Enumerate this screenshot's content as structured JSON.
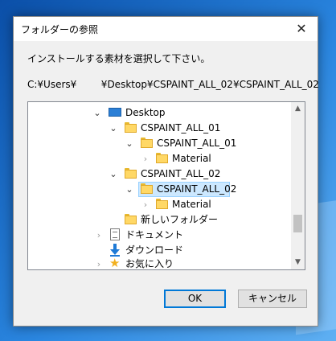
{
  "dialog": {
    "title": "フォルダーの参照",
    "close_glyph": "✕",
    "instruction": "インストールする素材を選択して下さい。",
    "path": "C:¥Users¥        ¥Desktop¥CSPAINT_ALL_02¥CSPAINT_ALL_02"
  },
  "tree": {
    "items": [
      {
        "label": "Desktop",
        "expanded": true,
        "icon": "desktop-icon"
      },
      {
        "label": "CSPAINT_ALL_01",
        "expanded": true,
        "icon": "folder-icon"
      },
      {
        "label": "CSPAINT_ALL_01",
        "expanded": true,
        "icon": "folder-icon"
      },
      {
        "label": "Material",
        "expanded": false,
        "icon": "folder-icon"
      },
      {
        "label": "CSPAINT_ALL_02",
        "expanded": true,
        "icon": "folder-icon"
      },
      {
        "label": "CSPAINT_ALL_02",
        "expanded": true,
        "icon": "folder-icon",
        "selected": true
      },
      {
        "label": "Material",
        "expanded": false,
        "icon": "folder-icon"
      },
      {
        "label": "新しいフォルダー",
        "icon": "folder-icon"
      },
      {
        "label": "ドキュメント",
        "expanded": false,
        "icon": "document-icon"
      },
      {
        "label": "ダウンロード",
        "icon": "download-icon"
      },
      {
        "label": "お気に入り",
        "expanded": false,
        "icon": "star-icon"
      }
    ]
  },
  "buttons": {
    "ok": "OK",
    "cancel": "キャンセル"
  },
  "colors": {
    "selection": "#cce8ff",
    "folder": "#ffd866",
    "accent": "#0078d7"
  }
}
